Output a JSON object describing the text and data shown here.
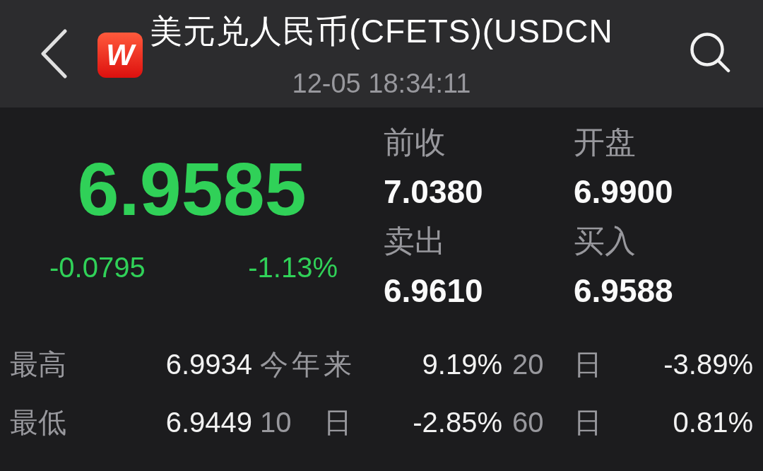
{
  "header": {
    "title": "美元兑人民币(CFETS)(USDCN",
    "timestamp": "12-05 18:34:11"
  },
  "floating_app": {
    "letter": "W"
  },
  "quote": {
    "price": "6.9585",
    "change": "-0.0795",
    "change_percent": "-1.13%",
    "falling": true
  },
  "fields": [
    {
      "label": "前收",
      "value": "7.0380"
    },
    {
      "label": "开盘",
      "value": "6.9900"
    },
    {
      "label": "卖出",
      "value": "6.9610"
    },
    {
      "label": "买入",
      "value": "6.9588"
    }
  ],
  "stats": [
    {
      "label": "最高",
      "value": "6.9934",
      "periods": [
        {
          "label": "今年来",
          "change": "9.19%"
        },
        {
          "label": "20 日",
          "change": "-3.89%"
        }
      ]
    },
    {
      "label": "最低",
      "value": "6.9449",
      "periods": [
        {
          "label": "10 日",
          "change": "-2.85%"
        },
        {
          "label": "60 日",
          "change": "0.81%"
        }
      ]
    }
  ]
}
